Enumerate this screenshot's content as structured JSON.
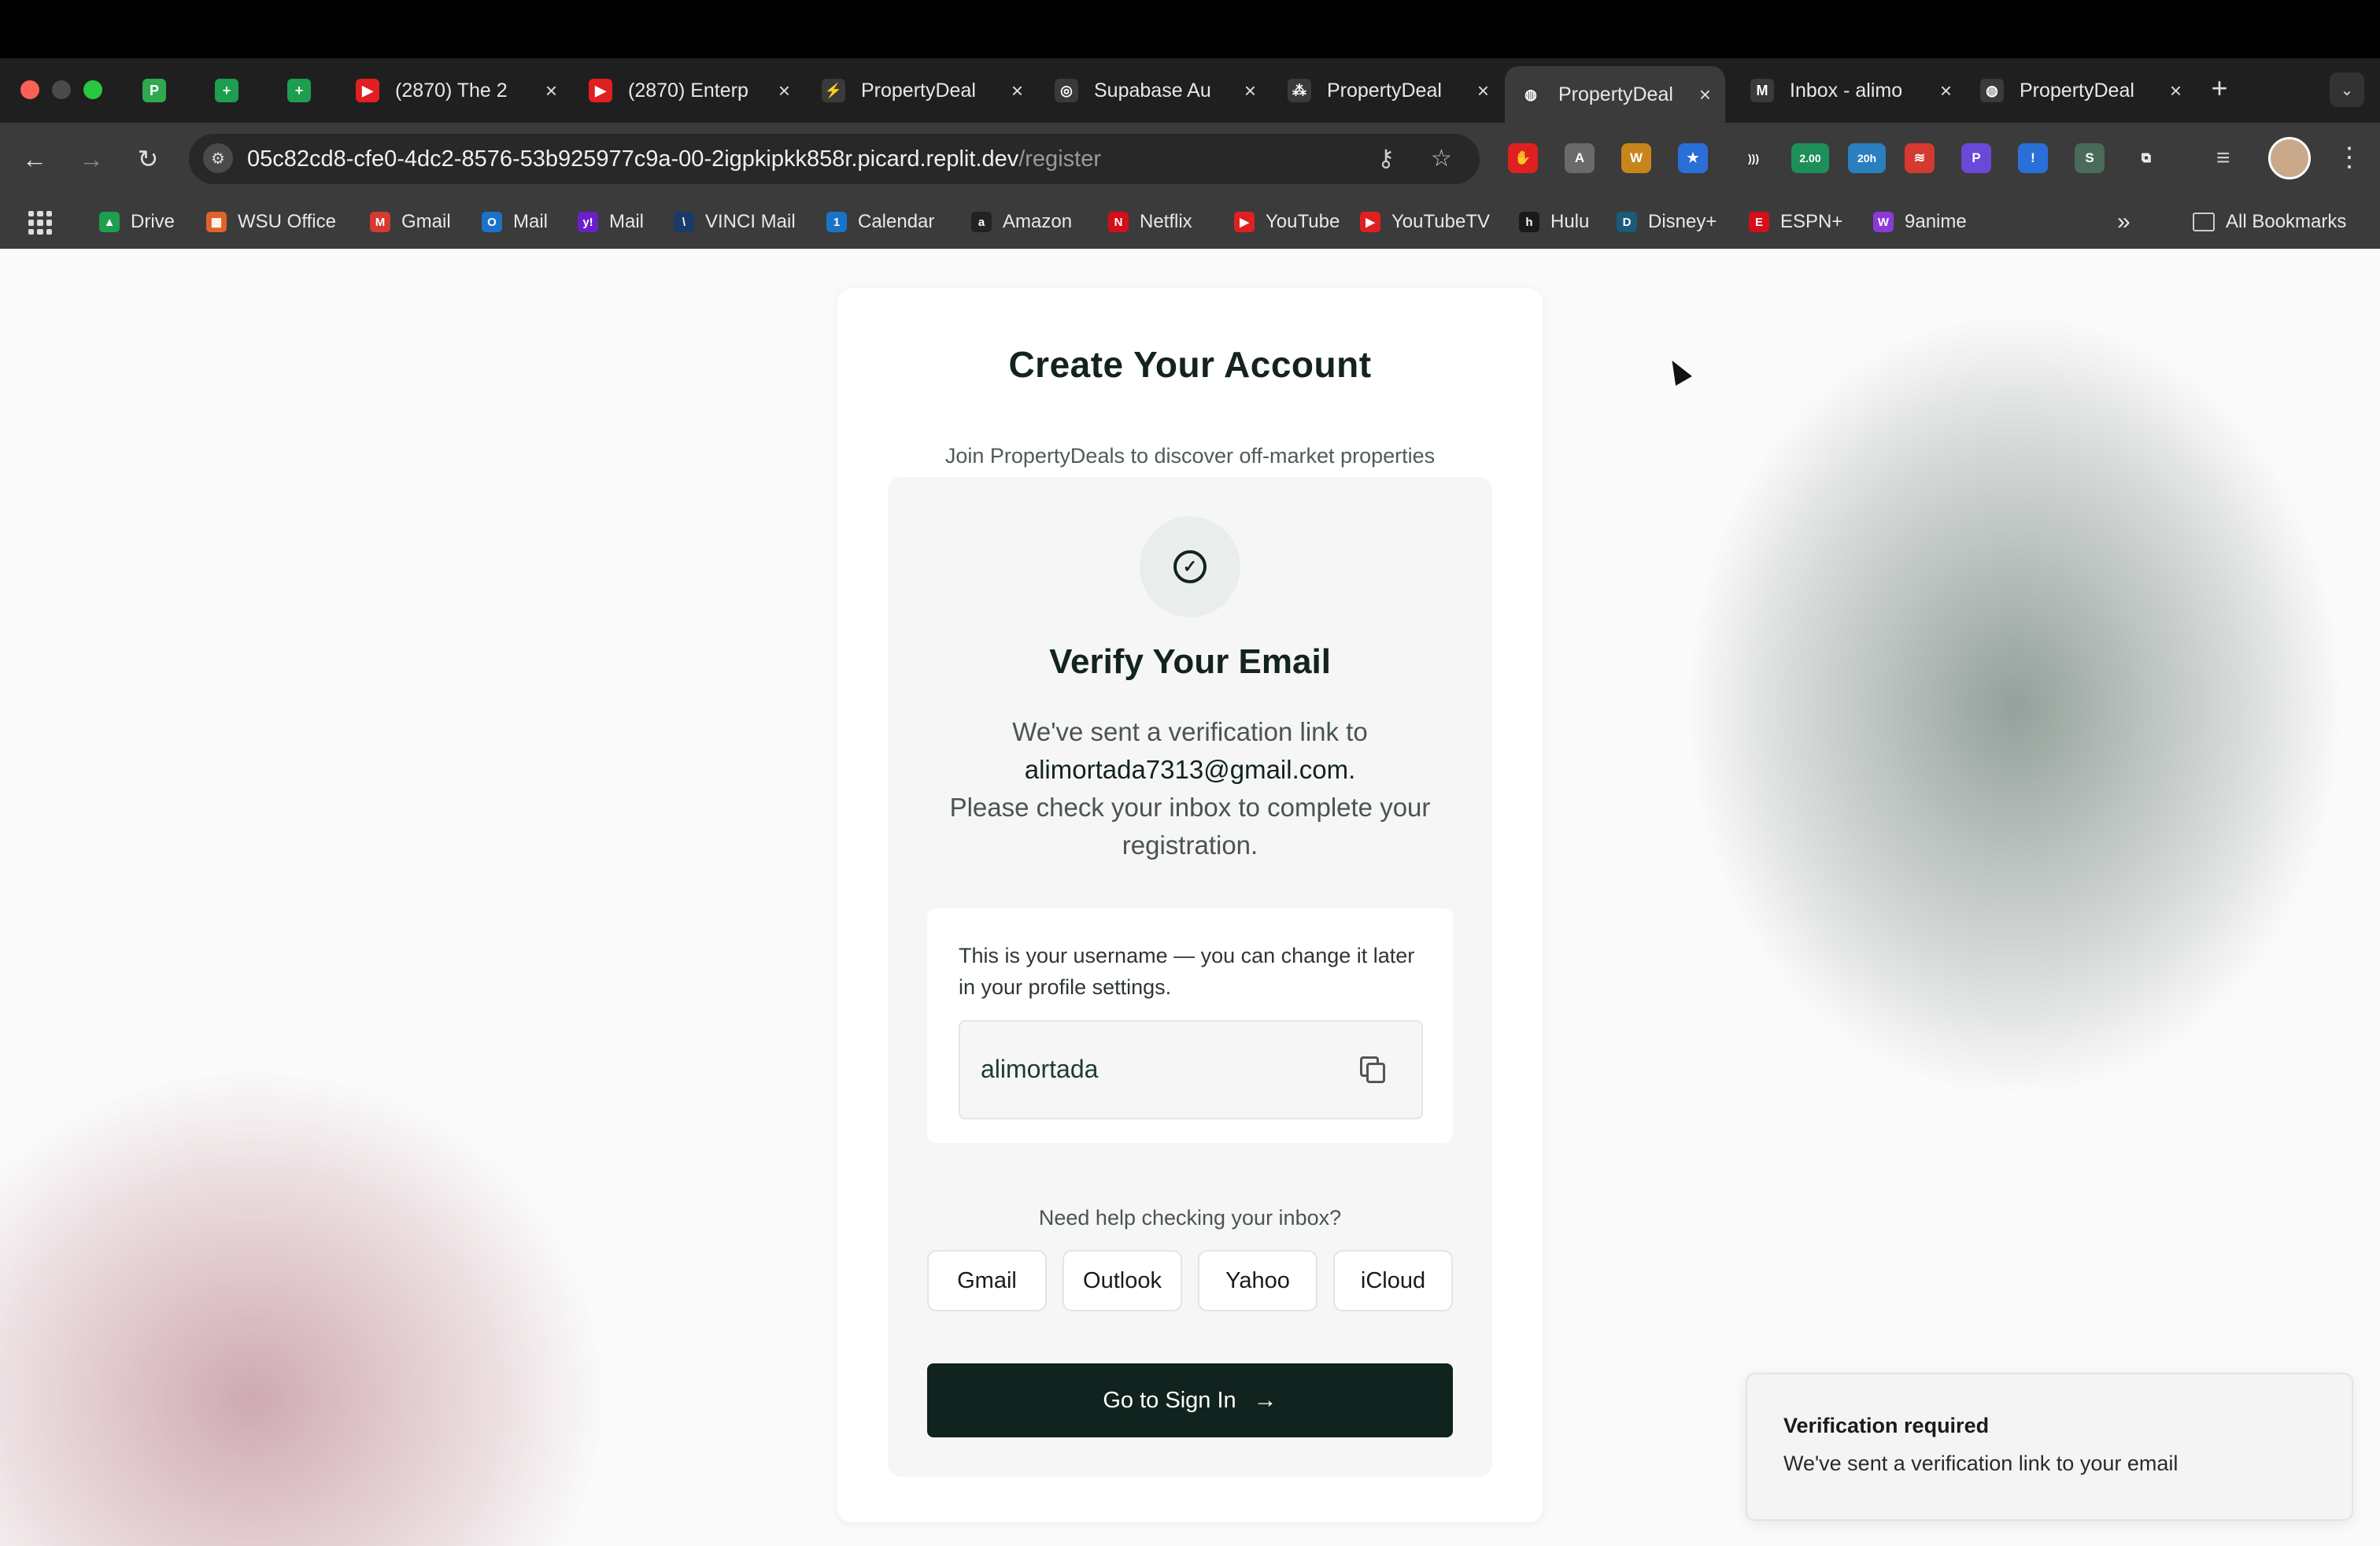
{
  "browser": {
    "tabs": [
      {
        "title": "",
        "icon": "P",
        "color": "#2fa84f",
        "pinned": true
      },
      {
        "title": "",
        "icon": "+",
        "color": "#1e9e4f",
        "pinned": true
      },
      {
        "title": "",
        "icon": "+",
        "color": "#1e9e4f",
        "pinned": true
      },
      {
        "title": "(2870) The 2",
        "icon": "▶",
        "color": "#e02020"
      },
      {
        "title": "(2870) Enterp",
        "icon": "▶",
        "color": "#e02020"
      },
      {
        "title": "PropertyDeal",
        "icon": "⚡",
        "color": "#3a3a3a"
      },
      {
        "title": "Supabase Au",
        "icon": "◎",
        "color": "#3a3a3a"
      },
      {
        "title": "PropertyDeal",
        "icon": "⁂",
        "color": "#3a3a3a"
      },
      {
        "title": "PropertyDeal",
        "icon": "◍",
        "color": "#3a3a3a",
        "active": true
      },
      {
        "title": "Inbox - alimo",
        "icon": "M",
        "color": "#3a3a3a"
      },
      {
        "title": "PropertyDeal",
        "icon": "◍",
        "color": "#3a3a3a"
      }
    ],
    "url_host": "05c82cd8-cfe0-4dc2-8576-53b925977c9a-00-2igpkipkk858r.picard.replit.dev",
    "url_path": "/register",
    "extensions": [
      {
        "label": "✋",
        "color": "#e02020"
      },
      {
        "label": "A",
        "color": "#6a6a6a"
      },
      {
        "label": "W",
        "color": "#c7851c"
      },
      {
        "label": "★",
        "color": "#2a6fd8"
      },
      {
        "label": ")))",
        "color": "#3a3a3a"
      },
      {
        "label": "2.00",
        "color": "#1f8f5a"
      },
      {
        "label": "20h",
        "color": "#2a7fbf"
      },
      {
        "label": "≋",
        "color": "#d43a2f"
      },
      {
        "label": "P",
        "color": "#6a48d8"
      },
      {
        "label": "!",
        "color": "#2a6fd8"
      },
      {
        "label": "S",
        "color": "#4a6a5a"
      },
      {
        "label": "⧉",
        "color": "#3a3a3a"
      }
    ],
    "bookmarks": [
      {
        "label": "Drive",
        "icon": "▲",
        "color": "#1e9e4f"
      },
      {
        "label": "WSU Office",
        "icon": "▦",
        "color": "#e0622a"
      },
      {
        "label": "Gmail",
        "icon": "M",
        "color": "#d43a2f"
      },
      {
        "label": "Mail",
        "icon": "O",
        "color": "#1a73c8"
      },
      {
        "label": "Mail",
        "icon": "y!",
        "color": "#6b1fc8"
      },
      {
        "label": "VINCI Mail",
        "icon": "\\",
        "color": "#1a3a6a"
      },
      {
        "label": "Calendar",
        "icon": "1",
        "color": "#1a73c8"
      },
      {
        "label": "Amazon",
        "icon": "a",
        "color": "#222222"
      },
      {
        "label": "Netflix",
        "icon": "N",
        "color": "#d40f1a"
      },
      {
        "label": "YouTube",
        "icon": "▶",
        "color": "#e02020"
      },
      {
        "label": "YouTubeTV",
        "icon": "▶",
        "color": "#e02020"
      },
      {
        "label": "Hulu",
        "icon": "h",
        "color": "#1a1a1a"
      },
      {
        "label": "Disney+",
        "icon": "D",
        "color": "#1a5a7a"
      },
      {
        "label": "ESPN+",
        "icon": "E",
        "color": "#d40f1a"
      },
      {
        "label": "9anime",
        "icon": "W",
        "color": "#8a3ad8"
      }
    ],
    "overflow_label": "»",
    "all_bookmarks": "All Bookmarks"
  },
  "card": {
    "title": "Create Your Account",
    "subtitle": "Join PropertyDeals to discover off-market properties",
    "verify_title": "Verify Your Email",
    "verify_line1": "We've sent a verification link to",
    "email": "alimortada7313@gmail.com.",
    "verify_line3": "Please check your inbox to complete your registration.",
    "username_note": "This is your username — you can change it later in your profile settings.",
    "username": "alimortada",
    "help_text": "Need help checking your inbox?",
    "mail_providers": [
      "Gmail",
      "Outlook",
      "Yahoo",
      "iCloud"
    ],
    "signin_label": "Go to Sign In",
    "signin_arrow": "→"
  },
  "toast": {
    "title": "Verification required",
    "message": "We've sent a verification link to your email"
  },
  "colors": {
    "primary_button": "#10231e",
    "heading": "#13231d"
  }
}
